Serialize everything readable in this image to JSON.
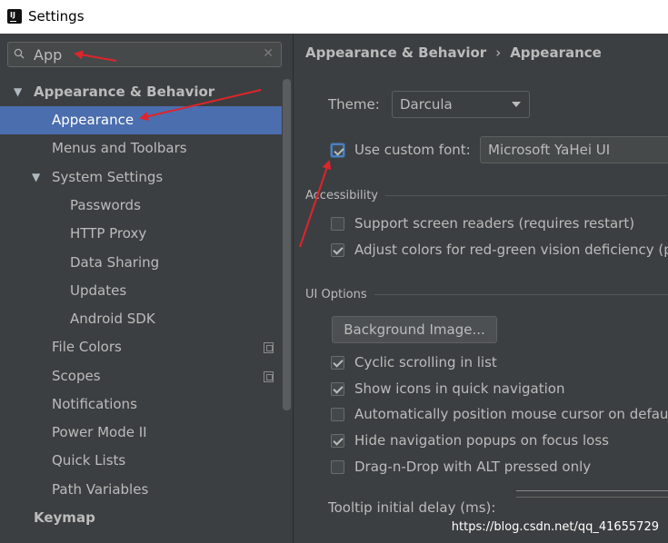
{
  "window": {
    "title": "Settings"
  },
  "sidebar": {
    "search": {
      "value": "App"
    },
    "items": [
      {
        "label": "Appearance & Behavior",
        "level": 0,
        "bold": true,
        "expanded": true
      },
      {
        "label": "Appearance",
        "level": 1,
        "selected": true
      },
      {
        "label": "Menus and Toolbars",
        "level": 1
      },
      {
        "label": "System Settings",
        "level": 1,
        "expanded": true
      },
      {
        "label": "Passwords",
        "level": 2
      },
      {
        "label": "HTTP Proxy",
        "level": 2
      },
      {
        "label": "Data Sharing",
        "level": 2
      },
      {
        "label": "Updates",
        "level": 2
      },
      {
        "label": "Android SDK",
        "level": 2
      },
      {
        "label": "File Colors",
        "level": 1,
        "copy_icon": true
      },
      {
        "label": "Scopes",
        "level": 1,
        "copy_icon": true
      },
      {
        "label": "Notifications",
        "level": 1
      },
      {
        "label": "Power Mode II",
        "level": 1
      },
      {
        "label": "Quick Lists",
        "level": 1
      },
      {
        "label": "Path Variables",
        "level": 1
      },
      {
        "label": "Keymap",
        "level": 0,
        "bold": true
      }
    ]
  },
  "content": {
    "breadcrumb": {
      "parent": "Appearance & Behavior",
      "separator": "›",
      "current": "Appearance"
    },
    "theme": {
      "label": "Theme:",
      "value": "Darcula"
    },
    "custom_font": {
      "label": "Use custom font:",
      "checked": true,
      "value": "Microsoft YaHei UI"
    },
    "accessibility": {
      "title": "Accessibility",
      "options": [
        {
          "label": "Support screen readers (requires restart)",
          "checked": false
        },
        {
          "label": "Adjust colors for red-green vision deficiency (pr",
          "checked": true
        }
      ]
    },
    "ui_options": {
      "title": "UI Options",
      "background_button": "Background Image...",
      "options": [
        {
          "label": "Cyclic scrolling in list",
          "checked": true
        },
        {
          "label": "Show icons in quick navigation",
          "checked": true
        },
        {
          "label": "Automatically position mouse cursor on default",
          "checked": false
        },
        {
          "label": "Hide navigation popups on focus loss",
          "checked": true
        },
        {
          "label": "Drag-n-Drop with ALT pressed only",
          "checked": false
        }
      ],
      "tooltip_delay_label": "Tooltip initial delay (ms):"
    }
  },
  "watermark": "https://blog.csdn.net/qq_41655729",
  "colors": {
    "selection": "#4b6eaf",
    "annotation_arrow": "#e0242b",
    "background": "#3c3f41"
  }
}
